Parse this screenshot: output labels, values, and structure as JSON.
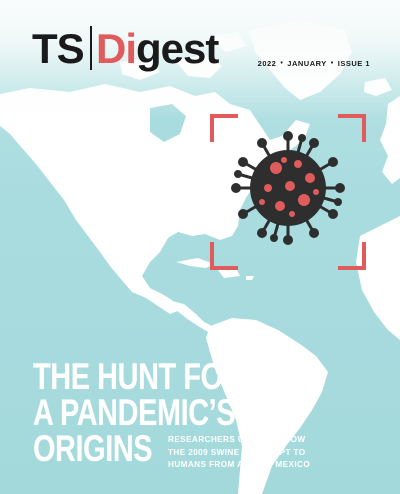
{
  "masthead": {
    "ts": "TS",
    "digest_prefix": "Di",
    "digest_suffix": "gest"
  },
  "issue_line": {
    "year": "2022",
    "month": "JANUARY",
    "issue": "ISSUE 1",
    "separator": "•"
  },
  "headline": {
    "line1": "THE HUNT FOR",
    "line2": "A PANDEMIC’S",
    "line3": "ORIGINS"
  },
  "subhead": {
    "line1": "RESEARCHERS UNCOVER HOW",
    "line2": "THE 2009 SWINE FLU LEAPT TO",
    "line3": "HUMANS FROM A PIG IN MEXICO"
  },
  "colors": {
    "ocean": "#a9dcdf",
    "land": "#ffffff",
    "accent": "#e05c5c",
    "virus": "#2e2e2e",
    "text_dark": "#1a1a1a"
  },
  "icons": {
    "virus": "virus-icon",
    "viewfinder": "viewfinder-brackets"
  }
}
